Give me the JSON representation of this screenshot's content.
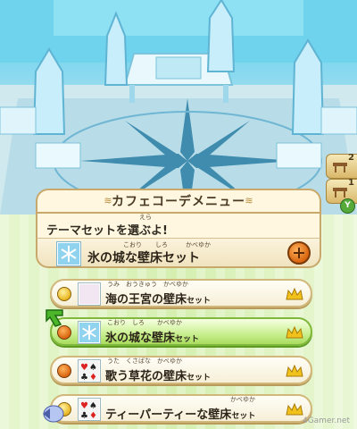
{
  "room": {
    "side_tabs": [
      {
        "count": "2"
      },
      {
        "count": "1"
      }
    ],
    "y_button": "Y"
  },
  "menu": {
    "title": "カフェコーデメニュー",
    "prompt": "テーマセットを選ぶよ!",
    "prompt_ruby": "えら",
    "current_selection": {
      "name": "氷の城な壁床セット",
      "ruby_left": "こおり",
      "ruby_mid": "しろ",
      "ruby_right": "かべゆか"
    },
    "items": [
      {
        "name_main": "海の王宮の壁床",
        "name_small": "セット",
        "ruby": "うみ　おうきゅう　かべゆか",
        "thumb": "shell",
        "coin": "gold",
        "selected": false
      },
      {
        "name_main": "氷の城な壁床",
        "name_small": "セット",
        "ruby": "こおり　しろ　　かべゆか",
        "thumb": "ice",
        "coin": "orange",
        "selected": true
      },
      {
        "name_main": "歌う草花の壁床",
        "name_small": "セット",
        "ruby": "うた　くさばな　かべゆか",
        "thumb": "cards",
        "coin": "orange",
        "selected": false
      },
      {
        "name_main": "ティーパーティーな壁床",
        "name_small": "セット",
        "ruby": "かべゆか",
        "thumb": "cards",
        "coin": "gold",
        "selected": false
      }
    ]
  },
  "watermark": "4Gamer.net",
  "colors": {
    "accent_green": "#a9dc60",
    "frame_gold": "#c8a86b",
    "ice_blue": "#8fd3ef"
  }
}
